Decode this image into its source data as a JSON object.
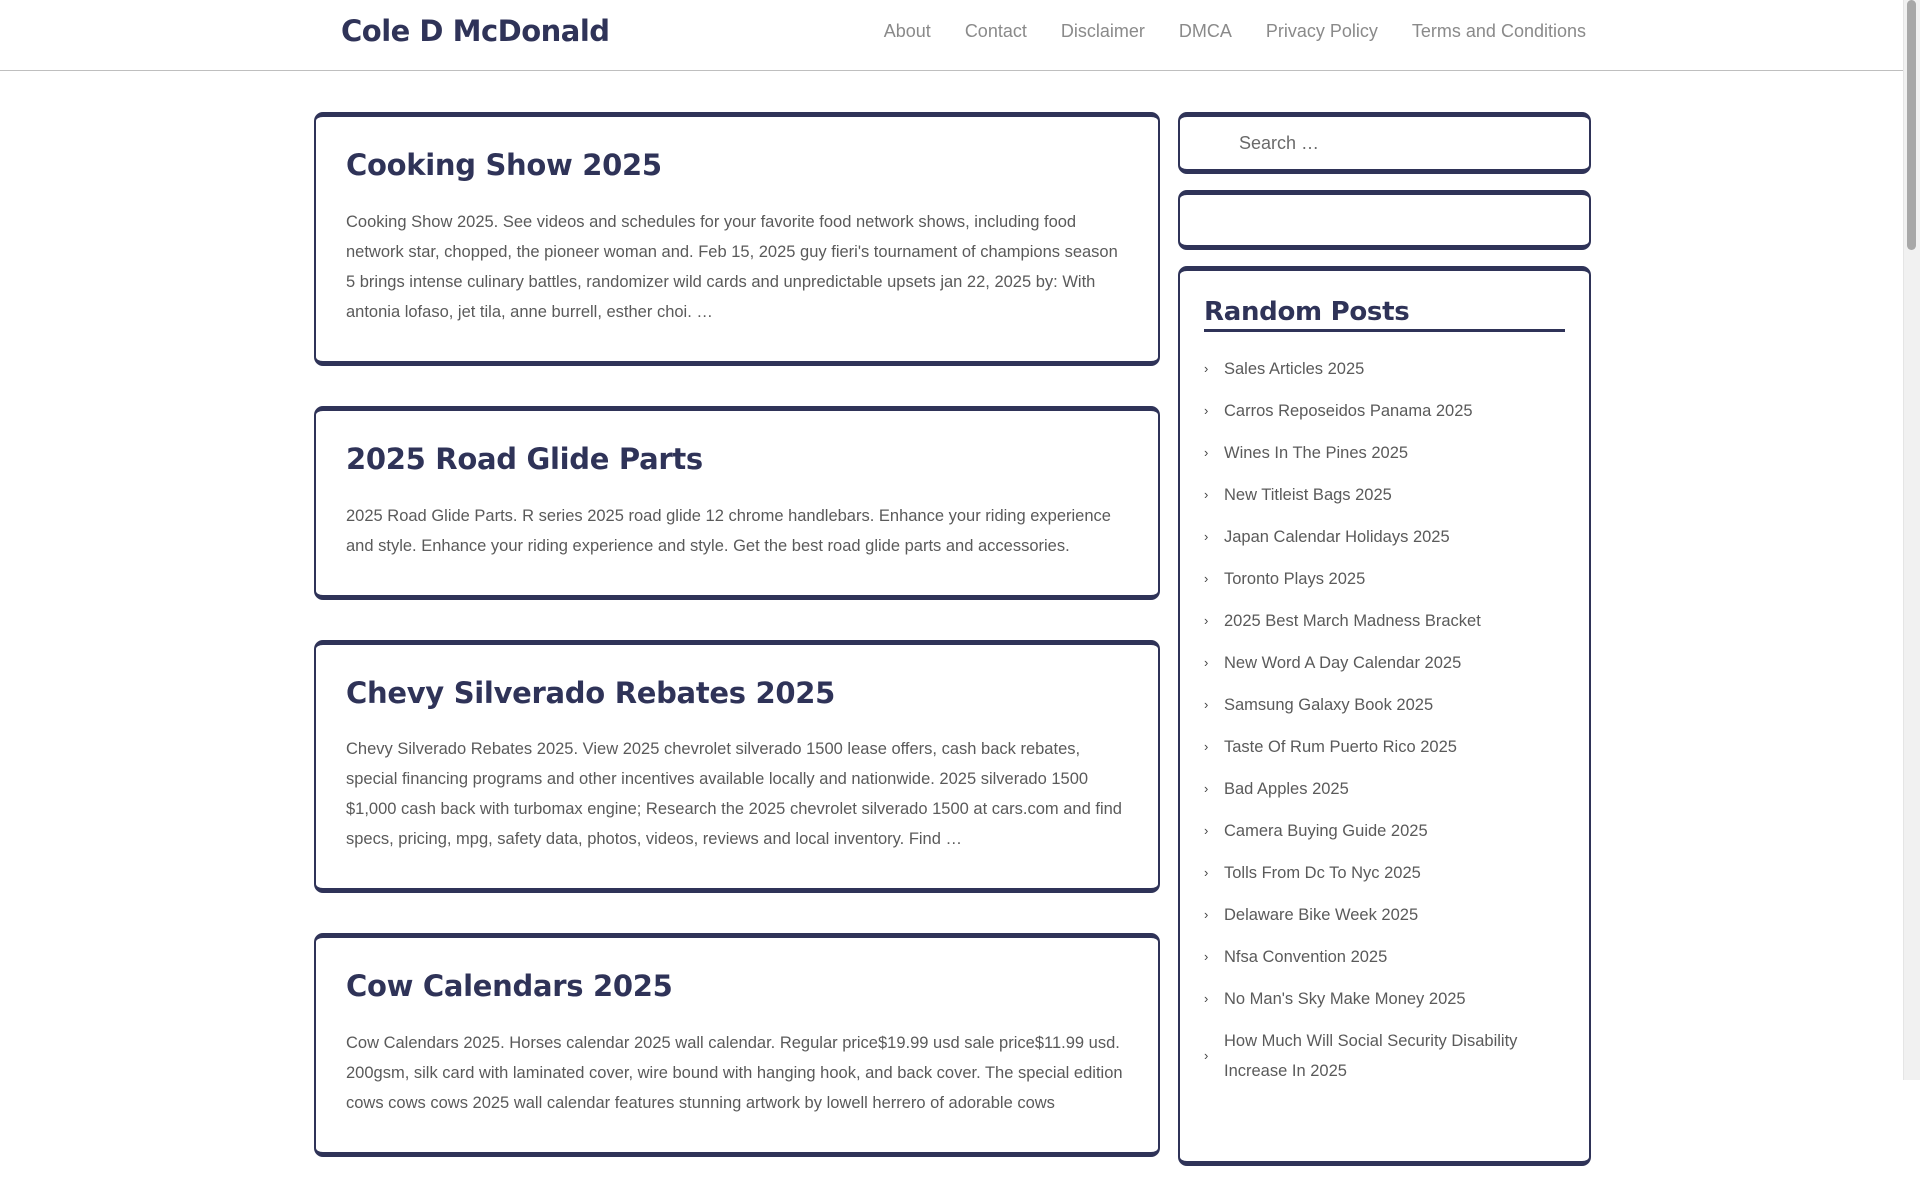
{
  "header": {
    "site_title": "Cole D McDonald",
    "nav": [
      "About",
      "Contact",
      "Disclaimer",
      "DMCA",
      "Privacy Policy",
      "Terms and Conditions"
    ]
  },
  "posts": [
    {
      "title": "Cooking Show 2025",
      "excerpt": "Cooking Show 2025. See videos and schedules for your favorite food network shows, including food network star, chopped, the pioneer woman and. Feb 15, 2025 guy fieri's tournament of champions season 5 brings intense culinary battles, randomizer wild cards and unpredictable upsets jan 22, 2025 by: With antonia lofaso, jet tila, anne burrell, esther choi. …"
    },
    {
      "title": "2025 Road Glide Parts",
      "excerpt": "2025 Road Glide Parts. R series 2025 road glide 12 chrome handlebars. Enhance your riding experience and style. Enhance your riding experience and style. Get the best road glide parts and accessories."
    },
    {
      "title": "Chevy Silverado Rebates 2025",
      "excerpt": "Chevy Silverado Rebates 2025. View 2025 chevrolet silverado 1500 lease offers, cash back rebates, special financing programs and other incentives available locally and nationwide. 2025 silverado 1500 $1,000 cash back with turbomax engine; Research the 2025 chevrolet silverado 1500 at cars.com and find specs, pricing, mpg, safety data, photos, videos, reviews and local inventory. Find …"
    },
    {
      "title": "Cow Calendars 2025",
      "excerpt": "Cow Calendars 2025. Horses calendar 2025 wall calendar. Regular price$19.99 usd sale price$11.99 usd. 200gsm, silk card with laminated cover, wire bound with hanging hook, and back cover. The special edition cows cows cows 2025 wall calendar features stunning artwork by lowell herrero of adorable cows"
    }
  ],
  "sidebar": {
    "search_placeholder": "Search …",
    "random_posts_title": "Random Posts",
    "random_posts": [
      "Sales Articles 2025",
      "Carros Reposeidos Panama 2025",
      "Wines In The Pines 2025",
      "New Titleist Bags 2025",
      "Japan Calendar Holidays 2025",
      "Toronto Plays 2025",
      "2025 Best March Madness Bracket",
      "New Word A Day Calendar 2025",
      "Samsung Galaxy Book 2025",
      "Taste Of Rum Puerto Rico 2025",
      "Bad Apples 2025",
      "Camera Buying Guide 2025",
      "Tolls From Dc To Nyc 2025",
      "Delaware Bike Week 2025",
      "Nfsa Convention 2025",
      "No Man's Sky Make Money 2025",
      "How Much Will Social Security Disability Increase In 2025"
    ]
  },
  "icons": {
    "list_bullet": "chevron-right-icon"
  },
  "colors": {
    "accent": "#2f3358",
    "nav_text": "#8a8a8a",
    "body_text": "#5a5a5a"
  }
}
